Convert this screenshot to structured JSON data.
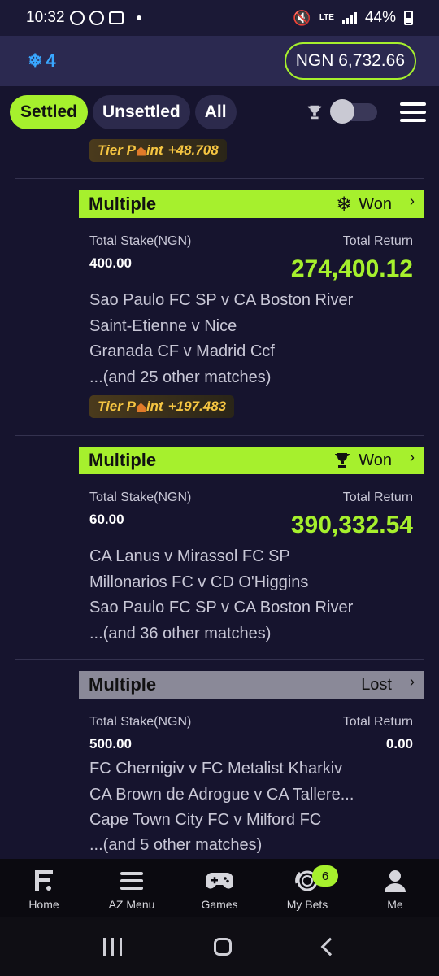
{
  "status_bar": {
    "time": "10:32",
    "lte": "LTE",
    "battery": "44%"
  },
  "header": {
    "snowflake_count": "4",
    "balance": "NGN 6,732.66"
  },
  "filters": {
    "settled": "Settled",
    "unsettled": "Unsettled",
    "all": "All"
  },
  "top_tier": {
    "label_pre": "Tier P",
    "label_post": "int",
    "value": "+48.708"
  },
  "bets": [
    {
      "type": "Multiple",
      "status": "Won",
      "status_icon": "snowflake-icon",
      "stake_label": "Total Stake(NGN)",
      "stake": "400.00",
      "return_label": "Total Return",
      "return": "274,400.12",
      "matches": [
        "Sao Paulo FC SP v CA Boston River",
        "Saint-Etienne v Nice",
        "Granada CF v Madrid Ccf"
      ],
      "more": "...(and 25 other matches)",
      "tier": {
        "label_pre": "Tier P",
        "label_post": "int",
        "value": "+197.483"
      }
    },
    {
      "type": "Multiple",
      "status": "Won",
      "status_icon": "trophy-icon",
      "stake_label": "Total Stake(NGN)",
      "stake": "60.00",
      "return_label": "Total Return",
      "return": "390,332.54",
      "matches": [
        "CA Lanus v Mirassol FC SP",
        "Millonarios FC v CD O'Higgins",
        "Sao Paulo FC SP v CA Boston River"
      ],
      "more": "...(and 36 other matches)"
    },
    {
      "type": "Multiple",
      "status": "Lost",
      "stake_label": "Total Stake(NGN)",
      "stake": "500.00",
      "return_label": "Total Return",
      "return": "0.00",
      "matches": [
        "FC Chernigiv v FC Metalist Kharkiv",
        "CA Brown de Adrogue v CA Tallere...",
        "Cape Town City FC v Milford FC"
      ],
      "more": "...(and 5 other matches)"
    }
  ],
  "bottom_nav": [
    {
      "label": "Home",
      "icon": "home-icon"
    },
    {
      "label": "AZ Menu",
      "icon": "menu-icon"
    },
    {
      "label": "Games",
      "icon": "gamepad-icon"
    },
    {
      "label": "My Bets",
      "icon": "bets-icon",
      "badge": "6"
    },
    {
      "label": "Me",
      "icon": "person-icon"
    }
  ],
  "colors": {
    "accent": "#a6f02d",
    "background": "#16142e",
    "header": "#2b2950",
    "lost": "#8a8998",
    "tier_gold": "#f5c542"
  }
}
